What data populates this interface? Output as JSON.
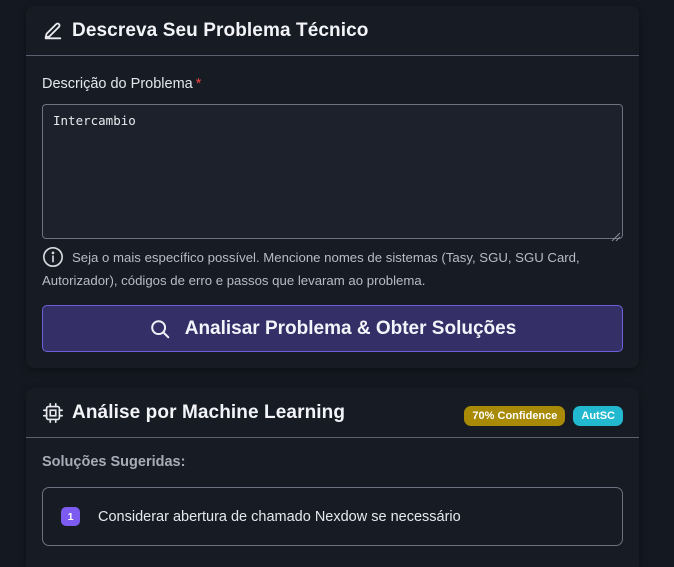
{
  "problem_card": {
    "title": "Descreva Seu Problema Técnico",
    "title_icon": "pencil-icon",
    "field_label": "Descrição do Problema",
    "required_marker": "*",
    "textarea_value": "Intercambio",
    "hint": "Seja o mais específico possível. Mencione nomes de sistemas (Tasy, SGU, SGU Card, Autorizador), códigos de erro e passos que levaram ao problema.",
    "hint_icon": "info-circle-icon",
    "analyze_button_label": "Analisar Problema & Obter Soluções",
    "analyze_button_icon": "search-icon"
  },
  "analysis_card": {
    "title": "Análise por Machine Learning",
    "title_icon": "cpu-chip-icon",
    "confidence_badge": "70% Confidence",
    "source_badge": "AutSC",
    "solutions_label": "Soluções Sugeridas:",
    "solutions": [
      {
        "number": "1",
        "text": "Considerar abertura de chamado Nexdow se necessário"
      }
    ]
  },
  "colors": {
    "page_background": "#141820",
    "card_background": "#171b23",
    "button_background": "#352f67",
    "button_border": "#6e5fd6",
    "required": "#ef4444",
    "confidence_badge": "#a88a06",
    "source_badge": "#22b8cf",
    "solution_number": "#7c5cf0"
  }
}
